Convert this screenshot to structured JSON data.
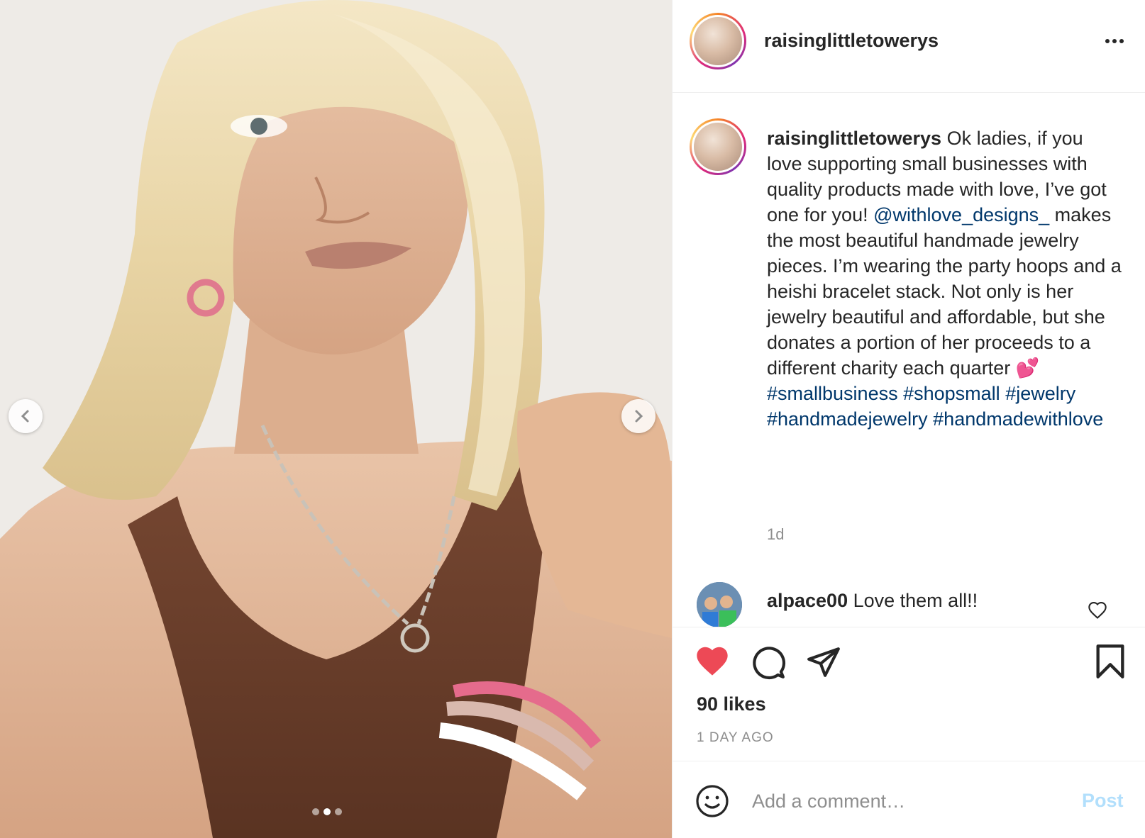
{
  "post": {
    "username": "raisinglittletowerys",
    "caption": {
      "username": "raisinglittletowerys",
      "text_part1": " Ok ladies, if you love supporting small businesses with quality products made with love, I’ve got one for you! ",
      "mention": "@withlove_designs_",
      "text_part2": " makes the most beautiful handmade jewelry pieces. I’m wearing the party hoops and a heishi bracelet stack. Not only is her jewelry beautiful and affordable, but she donates a portion of her proceeds to a different charity each quarter ",
      "emoji": "💕",
      "hashtags": [
        "#smallbusiness",
        "#shopsmall",
        "#jewelry",
        "#handmadejewelry",
        "#handmadewithlove"
      ],
      "time": "1d"
    },
    "comments": [
      {
        "username": "alpace00",
        "text": " Love them all!!"
      }
    ],
    "likes": "90 likes",
    "age": "1 DAY AGO",
    "add_comment": {
      "placeholder": "Add a comment…",
      "post_label": "Post"
    },
    "carousel": {
      "total": 3,
      "active_index": 1
    }
  },
  "icons": {
    "more": "more-options-icon",
    "prev": "chevron-left-icon",
    "next": "chevron-right-icon",
    "like": "heart-filled-icon",
    "comment": "comment-bubble-icon",
    "share": "paper-plane-icon",
    "save": "bookmark-icon",
    "emoji": "smiley-icon",
    "comment_like": "heart-outline-icon"
  },
  "colors": {
    "like_red": "#ed4956",
    "link_blue": "#00376b",
    "muted_gray": "#8e8e8e",
    "post_disabled": "#b2dffc"
  }
}
